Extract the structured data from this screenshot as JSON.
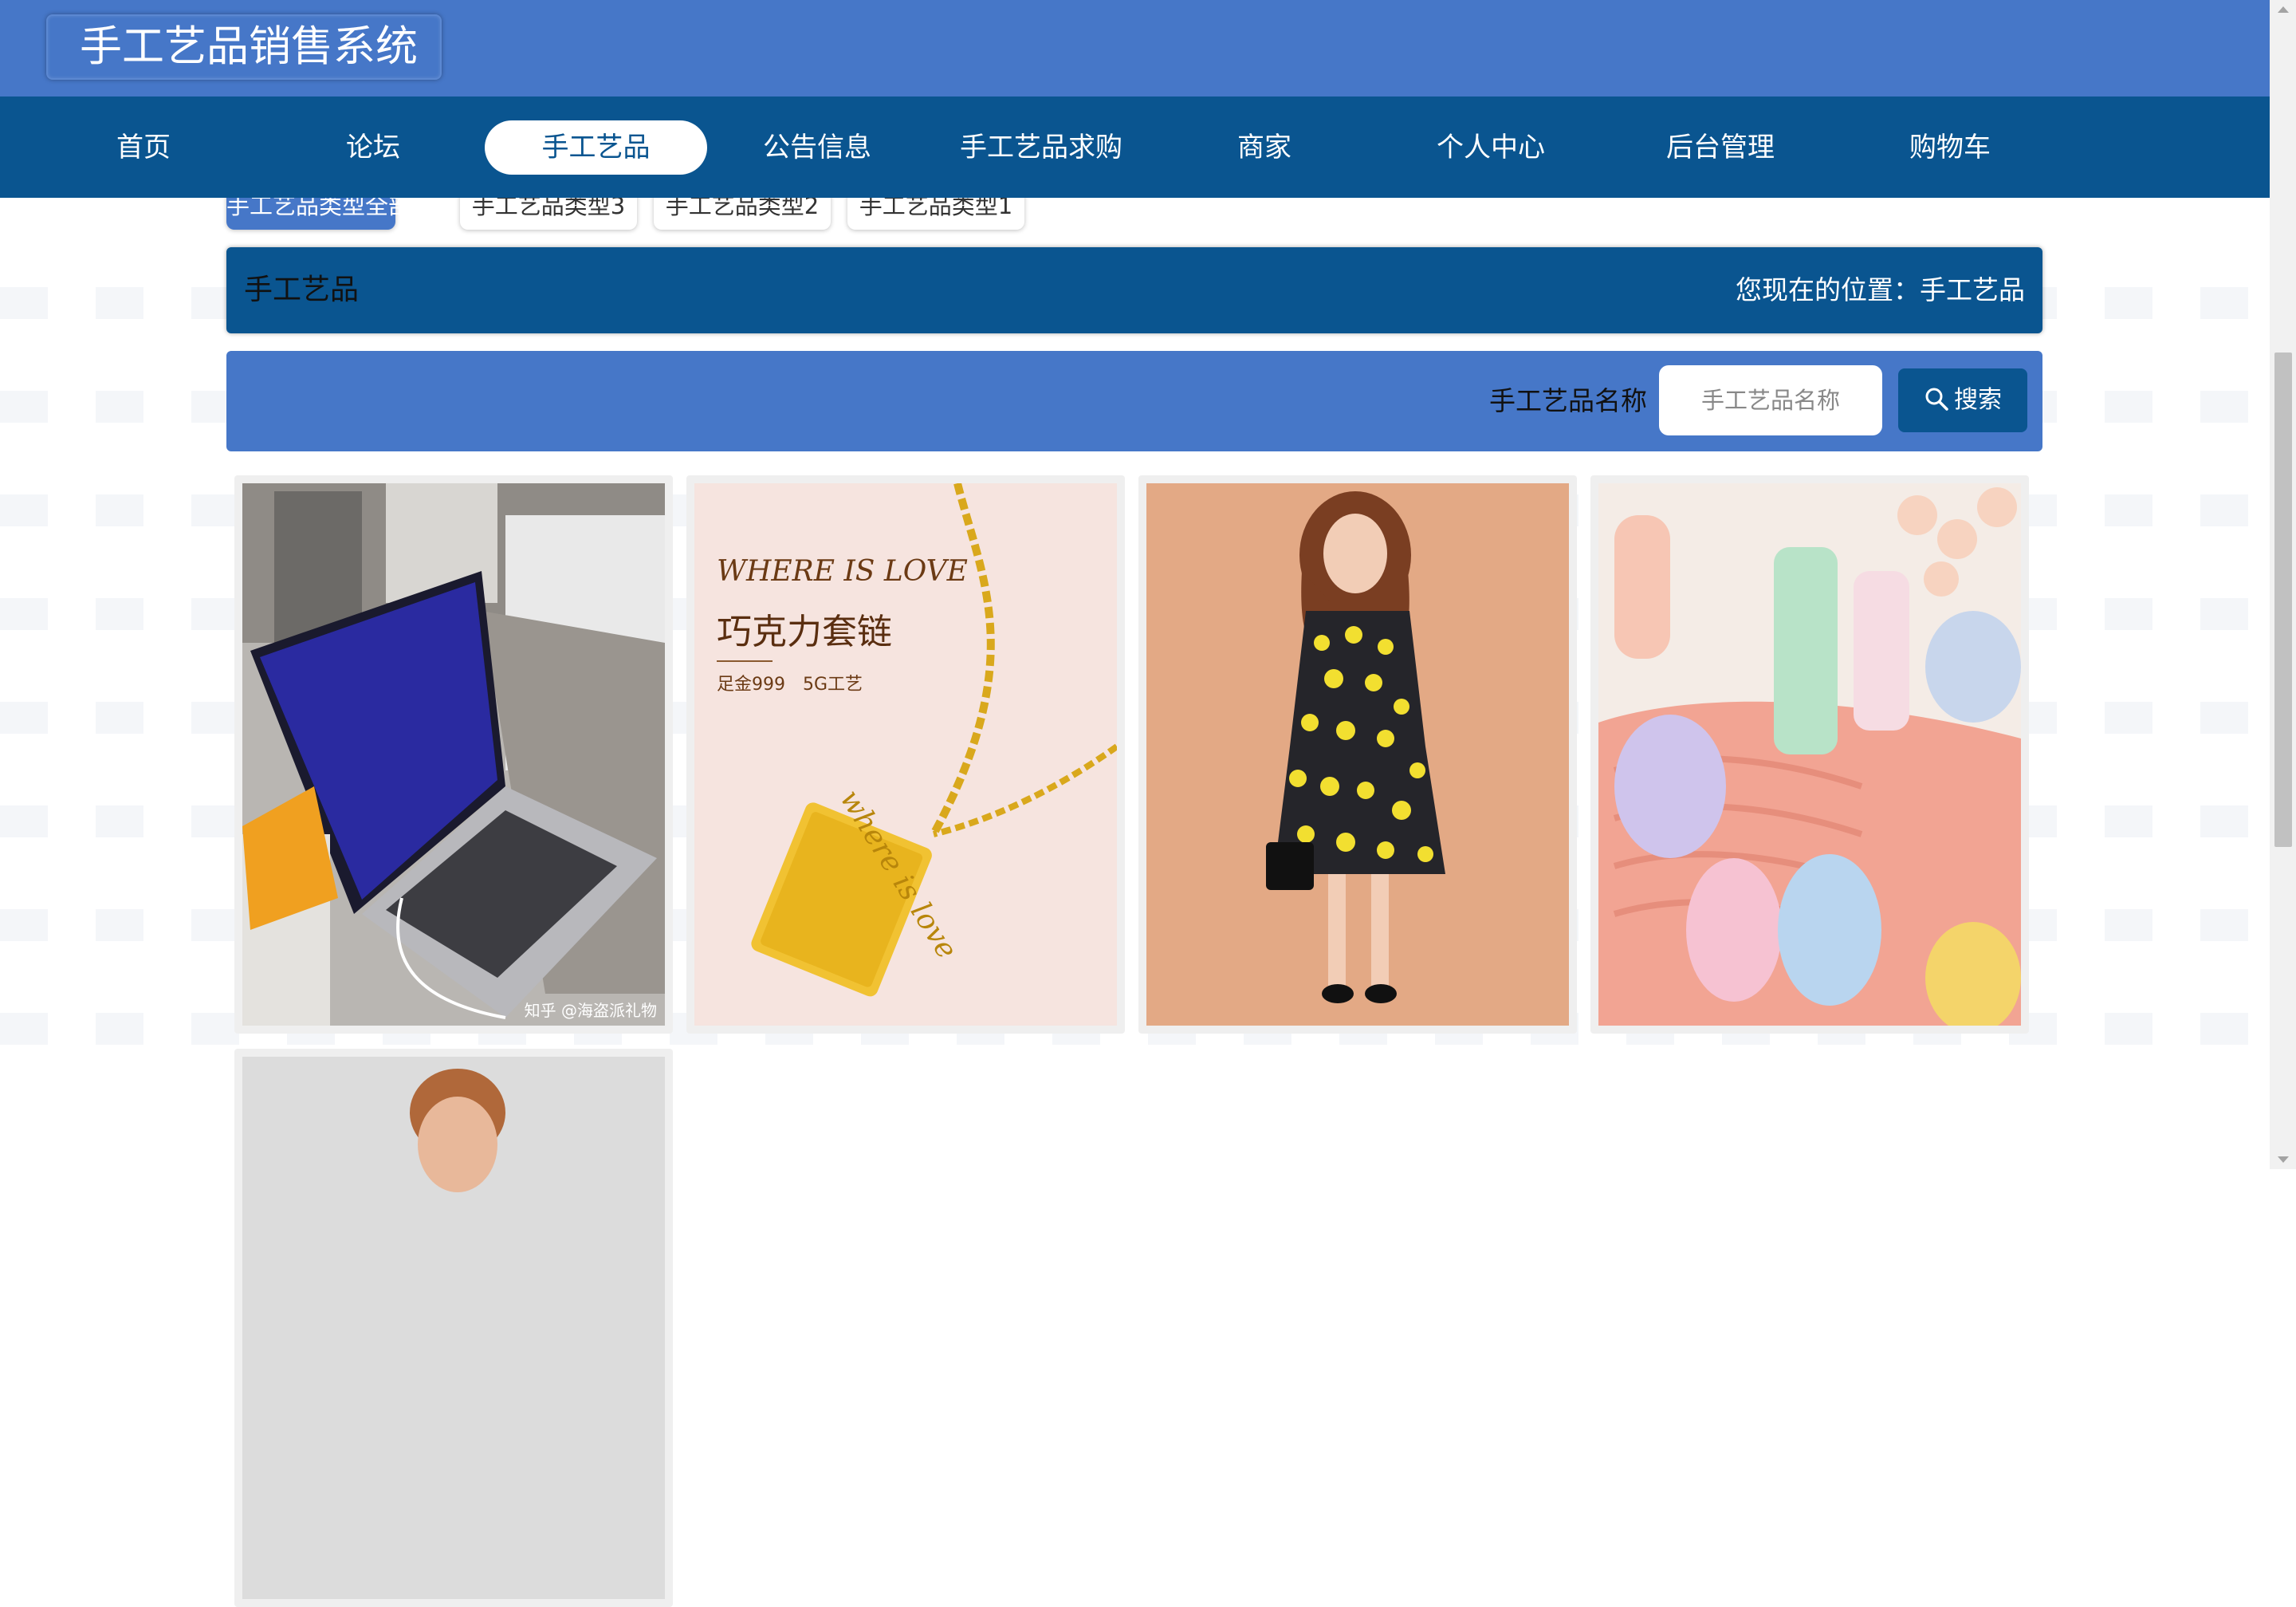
{
  "app_title": "手工艺品销售系统",
  "nav": [
    {
      "label": "首页",
      "active": false
    },
    {
      "label": "论坛",
      "active": false
    },
    {
      "label": "手工艺品",
      "active": true
    },
    {
      "label": "公告信息",
      "active": false
    },
    {
      "label": "手工艺品求购",
      "active": false
    },
    {
      "label": "商家",
      "active": false
    },
    {
      "label": "个人中心",
      "active": false
    },
    {
      "label": "后台管理",
      "active": false
    },
    {
      "label": "购物车",
      "active": false
    }
  ],
  "categories": [
    {
      "label": "手工艺品类型全部",
      "active": true
    },
    {
      "label": "手工艺品类型3",
      "active": false
    },
    {
      "label": "手工艺品类型2",
      "active": false
    },
    {
      "label": "手工艺品类型1",
      "active": false
    }
  ],
  "page_header": {
    "title": "手工艺品",
    "location": "您现在的位置：手工艺品"
  },
  "search": {
    "label": "手工艺品名称",
    "placeholder": "手工艺品名称",
    "value": "",
    "button_label": "搜索"
  },
  "products": [
    {
      "image": "laptop-photo",
      "image_caption": "知乎 @海盗派礼物"
    },
    {
      "image": "gold-necklace-photo",
      "headline": "WHERE IS LOVE",
      "title": "巧克力套链",
      "subtitle": "足金999　5G工艺",
      "engraving": "where is love"
    },
    {
      "image": "yellow-floral-dress-photo"
    },
    {
      "image": "pastel-hot-water-bottles-photo"
    },
    {
      "image": "man-portrait-photo"
    }
  ],
  "colors": {
    "primary": "#4677c8",
    "nav_bg": "#0a5590",
    "card_bg": "#efefef"
  }
}
